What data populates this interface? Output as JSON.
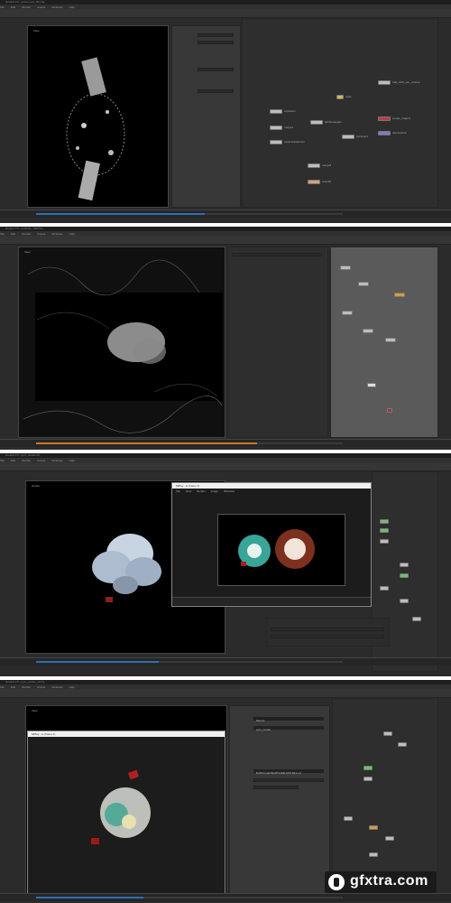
{
  "screens": [
    {
      "title": "Houdini FX - ocean_test_001.hip",
      "viewer_label": "View",
      "nodes": [
        "explosion",
        "merge1",
        "attribwrangle1",
        "pointvop1",
        "volumerasterize1",
        "merge2",
        "output0",
        "trail_cloth_sim_volume",
        "smoke_object1",
        "dopnetwork",
        "rest1"
      ],
      "menu": [
        "File",
        "Edit",
        "Render",
        "Assets",
        "Windows",
        "Help"
      ]
    },
    {
      "title": "Houdini FX - particles_v002.hip",
      "viewer_label": "View",
      "menu": [
        "File",
        "Edit",
        "Render",
        "Assets",
        "Windows",
        "Help"
      ]
    },
    {
      "title": "Houdini FX - pyro_render.hip",
      "viewer_label": "Output",
      "float_title": "MPlay - ip (frame 1)",
      "float_menu": [
        "File",
        "View",
        "Render",
        "Image",
        "Windows"
      ],
      "menu": [
        "File",
        "Edit",
        "Render",
        "Assets",
        "Windows",
        "Help"
      ]
    },
    {
      "title": "Houdini FX - pyro_render_v2.hip",
      "viewer_label": "View",
      "float_title": "MPlay - ip (frame 1)",
      "param_values": [
        "Mantra",
        "pyro_render",
        "$HIP/render/$HIPNAME.$OS.$F4.exr"
      ],
      "menu": [
        "File",
        "Edit",
        "Render",
        "Assets",
        "Windows",
        "Help"
      ]
    }
  ],
  "watermark": {
    "text": "gfxtra.com"
  }
}
